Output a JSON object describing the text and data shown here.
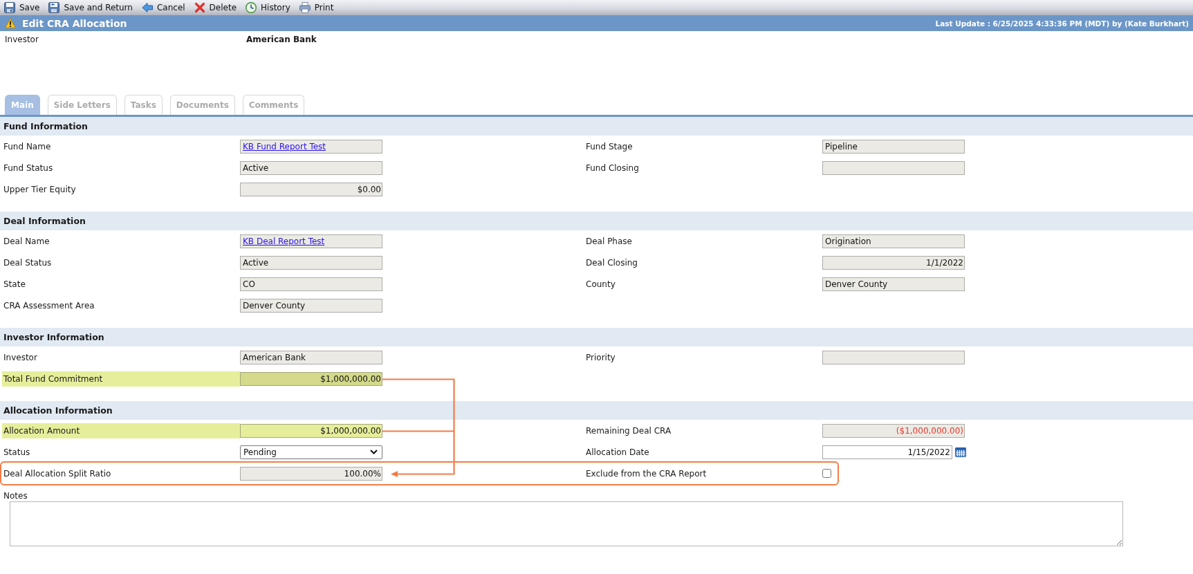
{
  "toolbar": [
    {
      "kind": "save",
      "label": "Save"
    },
    {
      "kind": "save-return",
      "label": "Save and Return"
    },
    {
      "kind": "cancel",
      "label": "Cancel"
    },
    {
      "kind": "delete",
      "label": "Delete"
    },
    {
      "kind": "history",
      "label": "History"
    },
    {
      "kind": "print",
      "label": "Print"
    }
  ],
  "header": {
    "title": "Edit CRA Allocation",
    "last_update": "Last Update : 6/25/2025 4:33:36 PM (MDT) by (Kate Burkhart)"
  },
  "summary": {
    "label": "Investor",
    "value": "American Bank"
  },
  "tabs": [
    {
      "label": "Main",
      "selected": true
    },
    {
      "label": "Side Letters",
      "selected": false
    },
    {
      "label": "Tasks",
      "selected": false
    },
    {
      "label": "Documents",
      "selected": false
    },
    {
      "label": "Comments",
      "selected": false
    }
  ],
  "sections": [
    {
      "title": "Fund Information",
      "rows": [
        {
          "highlighted": false,
          "framed": false,
          "left": {
            "label": "Fund Name",
            "field": {
              "kind": "link",
              "value": "KB Fund Report Test"
            }
          },
          "right": {
            "label": "Fund Stage",
            "field": {
              "kind": "text",
              "value": "Pipeline"
            }
          }
        },
        {
          "highlighted": false,
          "framed": false,
          "left": {
            "label": "Fund Status",
            "field": {
              "kind": "text",
              "value": "Active"
            }
          },
          "right": {
            "label": "Fund Closing",
            "field": {
              "kind": "text"
            }
          }
        },
        {
          "highlighted": false,
          "framed": false,
          "left": {
            "label": "Upper Tier Equity",
            "field": {
              "kind": "number",
              "value": "$0.00",
              "negative": false
            }
          }
        }
      ]
    },
    {
      "title": "Deal Information",
      "rows": [
        {
          "highlighted": false,
          "framed": false,
          "left": {
            "label": "Deal Name",
            "field": {
              "kind": "link",
              "value": "KB Deal Report Test"
            }
          },
          "right": {
            "label": "Deal Phase",
            "field": {
              "kind": "text",
              "value": "Origination"
            }
          }
        },
        {
          "highlighted": false,
          "framed": false,
          "left": {
            "label": "Deal Status",
            "field": {
              "kind": "text",
              "value": "Active"
            }
          },
          "right": {
            "label": "Deal Closing",
            "field": {
              "kind": "number",
              "value": "1/1/2022",
              "negative": false
            }
          }
        },
        {
          "highlighted": false,
          "framed": false,
          "left": {
            "label": "State",
            "field": {
              "kind": "text",
              "value": "CO"
            }
          },
          "right": {
            "label": "County",
            "field": {
              "kind": "text",
              "value": "Denver County"
            }
          }
        },
        {
          "highlighted": false,
          "framed": false,
          "left": {
            "label": "CRA Assessment Area",
            "field": {
              "kind": "text",
              "value": "Denver County"
            }
          }
        }
      ]
    },
    {
      "title": "Investor Information",
      "rows": [
        {
          "highlighted": false,
          "framed": false,
          "left": {
            "label": "Investor",
            "field": {
              "kind": "text",
              "value": "American Bank"
            }
          },
          "right": {
            "label": "Priority",
            "field": {
              "kind": "text"
            }
          }
        },
        {
          "highlighted": true,
          "framed": false,
          "left": {
            "label": "Total Fund Commitment",
            "field": {
              "kind": "number",
              "value": "$1,000,000.00",
              "negative": false
            }
          }
        }
      ]
    },
    {
      "title": "Allocation Information",
      "rows": [
        {
          "highlighted": true,
          "framed": false,
          "left": {
            "label": "Allocation Amount",
            "field": {
              "kind": "number-input",
              "value": "$1,000,000.00"
            }
          },
          "right": {
            "label": "Remaining Deal CRA",
            "field": {
              "kind": "number",
              "value": "($1,000,000.00)",
              "negative": true
            }
          }
        },
        {
          "highlighted": false,
          "framed": false,
          "left": {
            "label": "Status",
            "field": {
              "kind": "select",
              "value": "Pending"
            }
          },
          "right": {
            "label": "Allocation Date",
            "field": {
              "kind": "date",
              "value": "1/15/2022"
            }
          }
        },
        {
          "highlighted": false,
          "framed": true,
          "left": {
            "label": "Deal Allocation Split Ratio",
            "field": {
              "kind": "number",
              "value": "100.00%",
              "negative": false
            }
          },
          "right": {
            "label": "Exclude from the CRA Report",
            "field": {
              "kind": "checkbox",
              "checked": false
            }
          }
        }
      ]
    }
  ],
  "notes": {
    "label": "Notes"
  },
  "annotations": [
    {
      "kind": "arrow"
    }
  ]
}
